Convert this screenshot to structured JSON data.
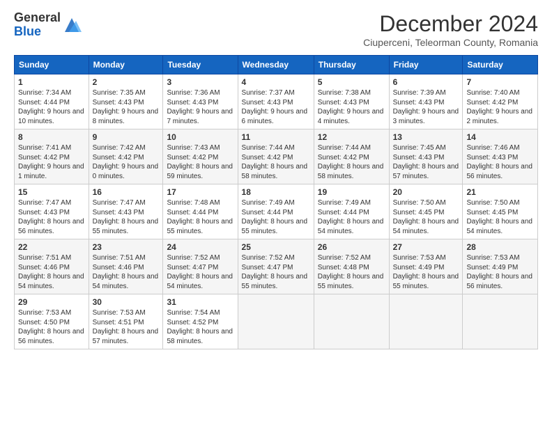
{
  "logo": {
    "general": "General",
    "blue": "Blue"
  },
  "title": "December 2024",
  "location": "Ciuperceni, Teleorman County, Romania",
  "weekdays": [
    "Sunday",
    "Monday",
    "Tuesday",
    "Wednesday",
    "Thursday",
    "Friday",
    "Saturday"
  ],
  "weeks": [
    [
      {
        "day": "1",
        "sunrise": "7:34 AM",
        "sunset": "4:44 PM",
        "daylight": "9 hours and 10 minutes."
      },
      {
        "day": "2",
        "sunrise": "7:35 AM",
        "sunset": "4:43 PM",
        "daylight": "9 hours and 8 minutes."
      },
      {
        "day": "3",
        "sunrise": "7:36 AM",
        "sunset": "4:43 PM",
        "daylight": "9 hours and 7 minutes."
      },
      {
        "day": "4",
        "sunrise": "7:37 AM",
        "sunset": "4:43 PM",
        "daylight": "9 hours and 6 minutes."
      },
      {
        "day": "5",
        "sunrise": "7:38 AM",
        "sunset": "4:43 PM",
        "daylight": "9 hours and 4 minutes."
      },
      {
        "day": "6",
        "sunrise": "7:39 AM",
        "sunset": "4:43 PM",
        "daylight": "9 hours and 3 minutes."
      },
      {
        "day": "7",
        "sunrise": "7:40 AM",
        "sunset": "4:42 PM",
        "daylight": "9 hours and 2 minutes."
      }
    ],
    [
      {
        "day": "8",
        "sunrise": "7:41 AM",
        "sunset": "4:42 PM",
        "daylight": "9 hours and 1 minute."
      },
      {
        "day": "9",
        "sunrise": "7:42 AM",
        "sunset": "4:42 PM",
        "daylight": "9 hours and 0 minutes."
      },
      {
        "day": "10",
        "sunrise": "7:43 AM",
        "sunset": "4:42 PM",
        "daylight": "8 hours and 59 minutes."
      },
      {
        "day": "11",
        "sunrise": "7:44 AM",
        "sunset": "4:42 PM",
        "daylight": "8 hours and 58 minutes."
      },
      {
        "day": "12",
        "sunrise": "7:44 AM",
        "sunset": "4:42 PM",
        "daylight": "8 hours and 58 minutes."
      },
      {
        "day": "13",
        "sunrise": "7:45 AM",
        "sunset": "4:43 PM",
        "daylight": "8 hours and 57 minutes."
      },
      {
        "day": "14",
        "sunrise": "7:46 AM",
        "sunset": "4:43 PM",
        "daylight": "8 hours and 56 minutes."
      }
    ],
    [
      {
        "day": "15",
        "sunrise": "7:47 AM",
        "sunset": "4:43 PM",
        "daylight": "8 hours and 56 minutes."
      },
      {
        "day": "16",
        "sunrise": "7:47 AM",
        "sunset": "4:43 PM",
        "daylight": "8 hours and 55 minutes."
      },
      {
        "day": "17",
        "sunrise": "7:48 AM",
        "sunset": "4:44 PM",
        "daylight": "8 hours and 55 minutes."
      },
      {
        "day": "18",
        "sunrise": "7:49 AM",
        "sunset": "4:44 PM",
        "daylight": "8 hours and 55 minutes."
      },
      {
        "day": "19",
        "sunrise": "7:49 AM",
        "sunset": "4:44 PM",
        "daylight": "8 hours and 54 minutes."
      },
      {
        "day": "20",
        "sunrise": "7:50 AM",
        "sunset": "4:45 PM",
        "daylight": "8 hours and 54 minutes."
      },
      {
        "day": "21",
        "sunrise": "7:50 AM",
        "sunset": "4:45 PM",
        "daylight": "8 hours and 54 minutes."
      }
    ],
    [
      {
        "day": "22",
        "sunrise": "7:51 AM",
        "sunset": "4:46 PM",
        "daylight": "8 hours and 54 minutes."
      },
      {
        "day": "23",
        "sunrise": "7:51 AM",
        "sunset": "4:46 PM",
        "daylight": "8 hours and 54 minutes."
      },
      {
        "day": "24",
        "sunrise": "7:52 AM",
        "sunset": "4:47 PM",
        "daylight": "8 hours and 54 minutes."
      },
      {
        "day": "25",
        "sunrise": "7:52 AM",
        "sunset": "4:47 PM",
        "daylight": "8 hours and 55 minutes."
      },
      {
        "day": "26",
        "sunrise": "7:52 AM",
        "sunset": "4:48 PM",
        "daylight": "8 hours and 55 minutes."
      },
      {
        "day": "27",
        "sunrise": "7:53 AM",
        "sunset": "4:49 PM",
        "daylight": "8 hours and 55 minutes."
      },
      {
        "day": "28",
        "sunrise": "7:53 AM",
        "sunset": "4:49 PM",
        "daylight": "8 hours and 56 minutes."
      }
    ],
    [
      {
        "day": "29",
        "sunrise": "7:53 AM",
        "sunset": "4:50 PM",
        "daylight": "8 hours and 56 minutes."
      },
      {
        "day": "30",
        "sunrise": "7:53 AM",
        "sunset": "4:51 PM",
        "daylight": "8 hours and 57 minutes."
      },
      {
        "day": "31",
        "sunrise": "7:54 AM",
        "sunset": "4:52 PM",
        "daylight": "8 hours and 58 minutes."
      },
      null,
      null,
      null,
      null
    ]
  ]
}
